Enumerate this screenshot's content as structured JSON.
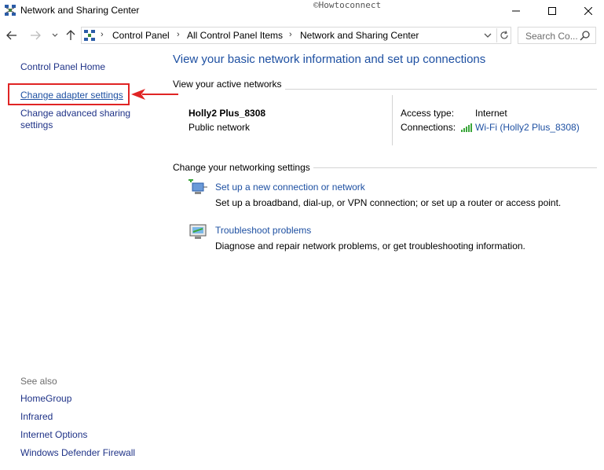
{
  "window": {
    "title": "Network and Sharing Center",
    "watermark": "©Howtoconnect"
  },
  "address": {
    "crumbs": [
      "Control Panel",
      "All Control Panel Items",
      "Network and Sharing Center"
    ],
    "search_placeholder": "Search Co..."
  },
  "sidebar": {
    "home": "Control Panel Home",
    "change_adapter": "Change adapter settings",
    "change_advanced": "Change advanced sharing settings",
    "see_also_label": "See also",
    "see_also": [
      "HomeGroup",
      "Infrared",
      "Internet Options",
      "Windows Defender Firewall"
    ]
  },
  "main": {
    "title": "View your basic network information and set up connections",
    "active_networks_head": "View your active networks",
    "network_name": "Holly2 Plus_8308",
    "network_type": "Public network",
    "access_type_label": "Access type:",
    "access_type_value": "Internet",
    "connections_label": "Connections:",
    "connections_value": "Wi-Fi (Holly2 Plus_8308)",
    "change_settings_head": "Change your networking settings",
    "tasks": [
      {
        "link": "Set up a new connection or network",
        "desc": "Set up a broadband, dial-up, or VPN connection; or set up a router or access point."
      },
      {
        "link": "Troubleshoot problems",
        "desc": "Diagnose and repair network problems, or get troubleshooting information."
      }
    ]
  },
  "colors": {
    "link": "#1e50a2",
    "highlight_box": "#e02424",
    "arrow": "#e02424"
  }
}
